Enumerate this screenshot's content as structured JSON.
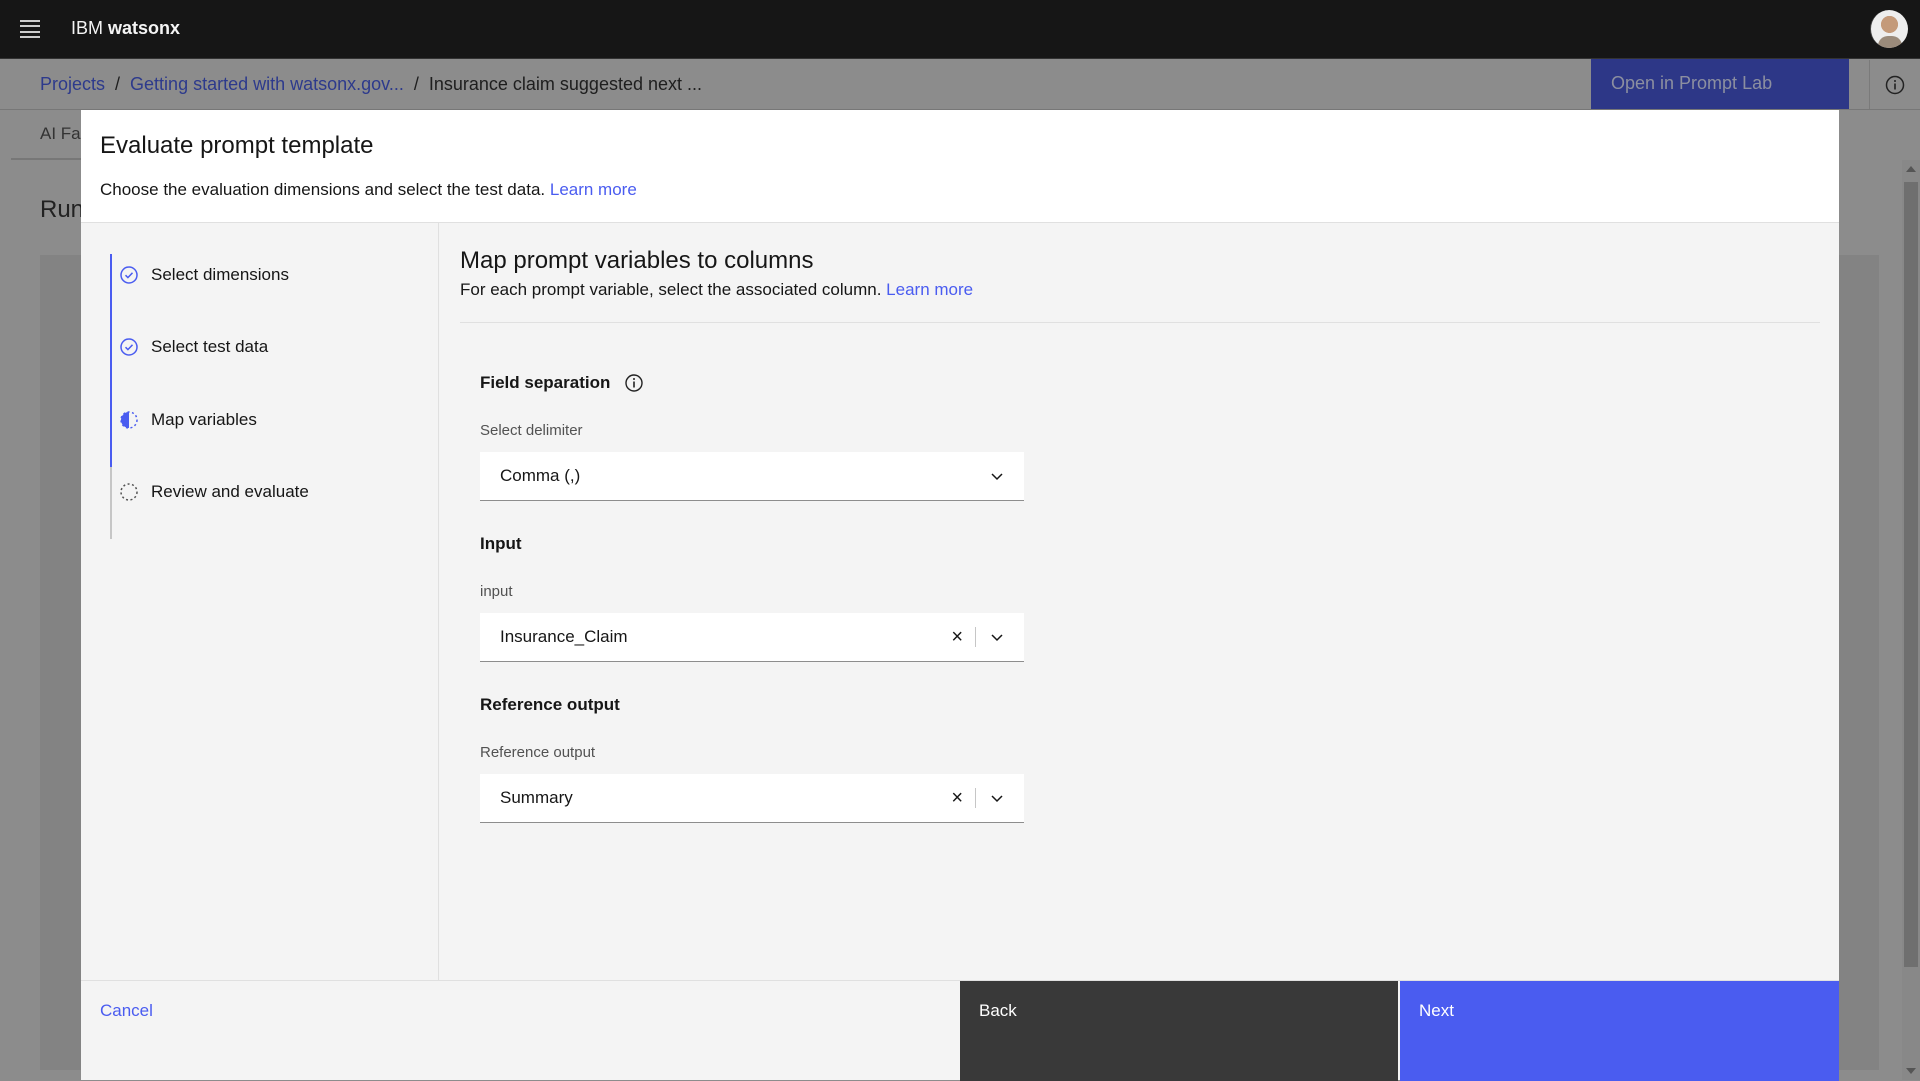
{
  "header": {
    "brand_prefix": "IBM",
    "brand_name": "watsonx"
  },
  "breadcrumb": {
    "items": [
      "Projects",
      "Getting started with watsonx.gov...",
      "Insurance claim suggested next ..."
    ],
    "separator": "/"
  },
  "page": {
    "open_button": "Open in Prompt Lab",
    "tab_partial": "AI Fa",
    "heading_partial": "Run"
  },
  "modal": {
    "title": "Evaluate prompt template",
    "subtitle": "Choose the evaluation dimensions and select the test data.",
    "learn_more": "Learn more",
    "steps": [
      {
        "label": "Select dimensions",
        "state": "complete"
      },
      {
        "label": "Select test data",
        "state": "complete"
      },
      {
        "label": "Map variables",
        "state": "current"
      },
      {
        "label": "Review and evaluate",
        "state": "incomplete"
      }
    ],
    "content": {
      "title": "Map prompt variables to columns",
      "subtitle": "For each prompt variable, select the associated column.",
      "learn_more": "Learn more",
      "field_separation": {
        "heading": "Field separation",
        "label": "Select delimiter",
        "value": "Comma (,)"
      },
      "input": {
        "heading": "Input",
        "label": "input",
        "value": "Insurance_Claim"
      },
      "reference": {
        "heading": "Reference output",
        "label": "Reference output",
        "value": "Summary"
      }
    },
    "footer": {
      "cancel": "Cancel",
      "back": "Back",
      "next": "Next"
    }
  },
  "colors": {
    "accent": "#4a5cf0",
    "topbar": "#161616",
    "secondary_button": "#393939"
  }
}
